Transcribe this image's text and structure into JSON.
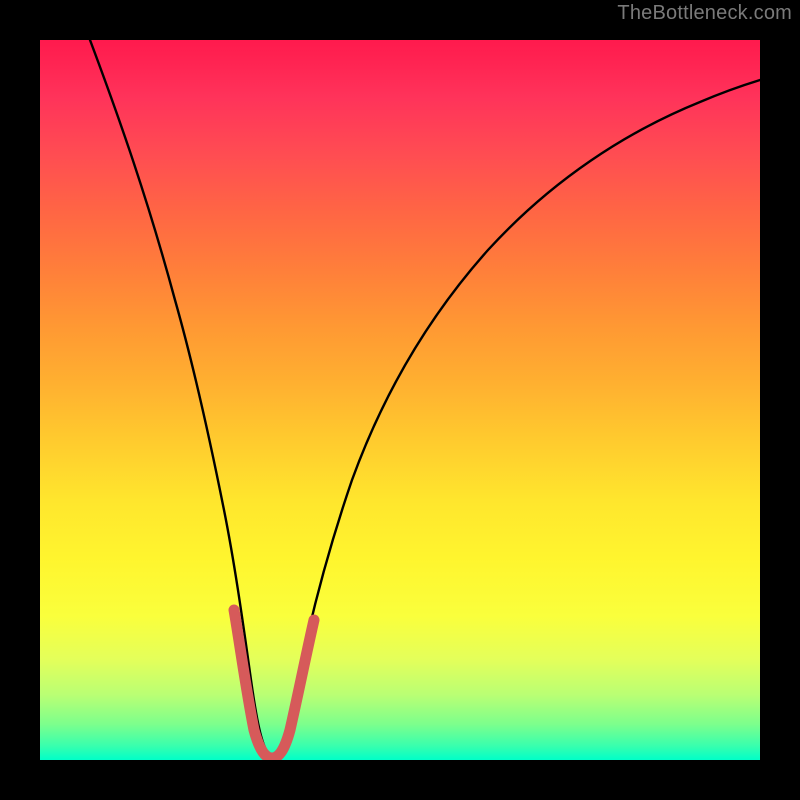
{
  "watermark": "TheBottleneck.com",
  "chart_data": {
    "type": "line",
    "title": "",
    "xlabel": "",
    "ylabel": "",
    "xlim": [
      0,
      100
    ],
    "ylim": [
      0,
      100
    ],
    "x": [
      0,
      4,
      8,
      12,
      16,
      20,
      22,
      24,
      26,
      28,
      29,
      30,
      31,
      32,
      34,
      36,
      40,
      44,
      50,
      56,
      62,
      70,
      78,
      86,
      94,
      100
    ],
    "values": [
      100,
      92,
      84,
      75,
      65,
      51,
      42,
      31,
      18,
      7,
      3,
      1,
      1,
      3,
      8,
      15,
      28,
      40,
      52,
      61,
      68,
      75,
      81,
      86,
      90,
      93
    ],
    "series": [
      {
        "name": "bottleneck-curve",
        "color": "#000000",
        "x": [
          0,
          4,
          8,
          12,
          16,
          20,
          22,
          24,
          26,
          28,
          29,
          30,
          31,
          32,
          34,
          36,
          40,
          44,
          50,
          56,
          62,
          70,
          78,
          86,
          94,
          100
        ],
        "y": [
          100,
          92,
          84,
          75,
          65,
          51,
          42,
          31,
          18,
          7,
          3,
          1,
          1,
          3,
          8,
          15,
          28,
          40,
          52,
          61,
          68,
          75,
          81,
          86,
          90,
          93
        ]
      },
      {
        "name": "highlight-segment",
        "color": "#d65a5a",
        "x": [
          25,
          26,
          27,
          28,
          29,
          30,
          31,
          32,
          33,
          34,
          35
        ],
        "y": [
          22,
          17,
          11,
          6,
          3,
          1,
          1,
          3,
          6,
          10,
          13
        ]
      }
    ],
    "gradient_stops": [
      {
        "pos": 0.0,
        "color": "#ff1a4d"
      },
      {
        "pos": 0.16,
        "color": "#ff4d52"
      },
      {
        "pos": 0.32,
        "color": "#ff7f3a"
      },
      {
        "pos": 0.48,
        "color": "#ffb130"
      },
      {
        "pos": 0.64,
        "color": "#ffe62d"
      },
      {
        "pos": 0.8,
        "color": "#faff3c"
      },
      {
        "pos": 0.91,
        "color": "#b9ff74"
      },
      {
        "pos": 1.0,
        "color": "#00ffc8"
      }
    ],
    "grid": false,
    "legend": false
  }
}
